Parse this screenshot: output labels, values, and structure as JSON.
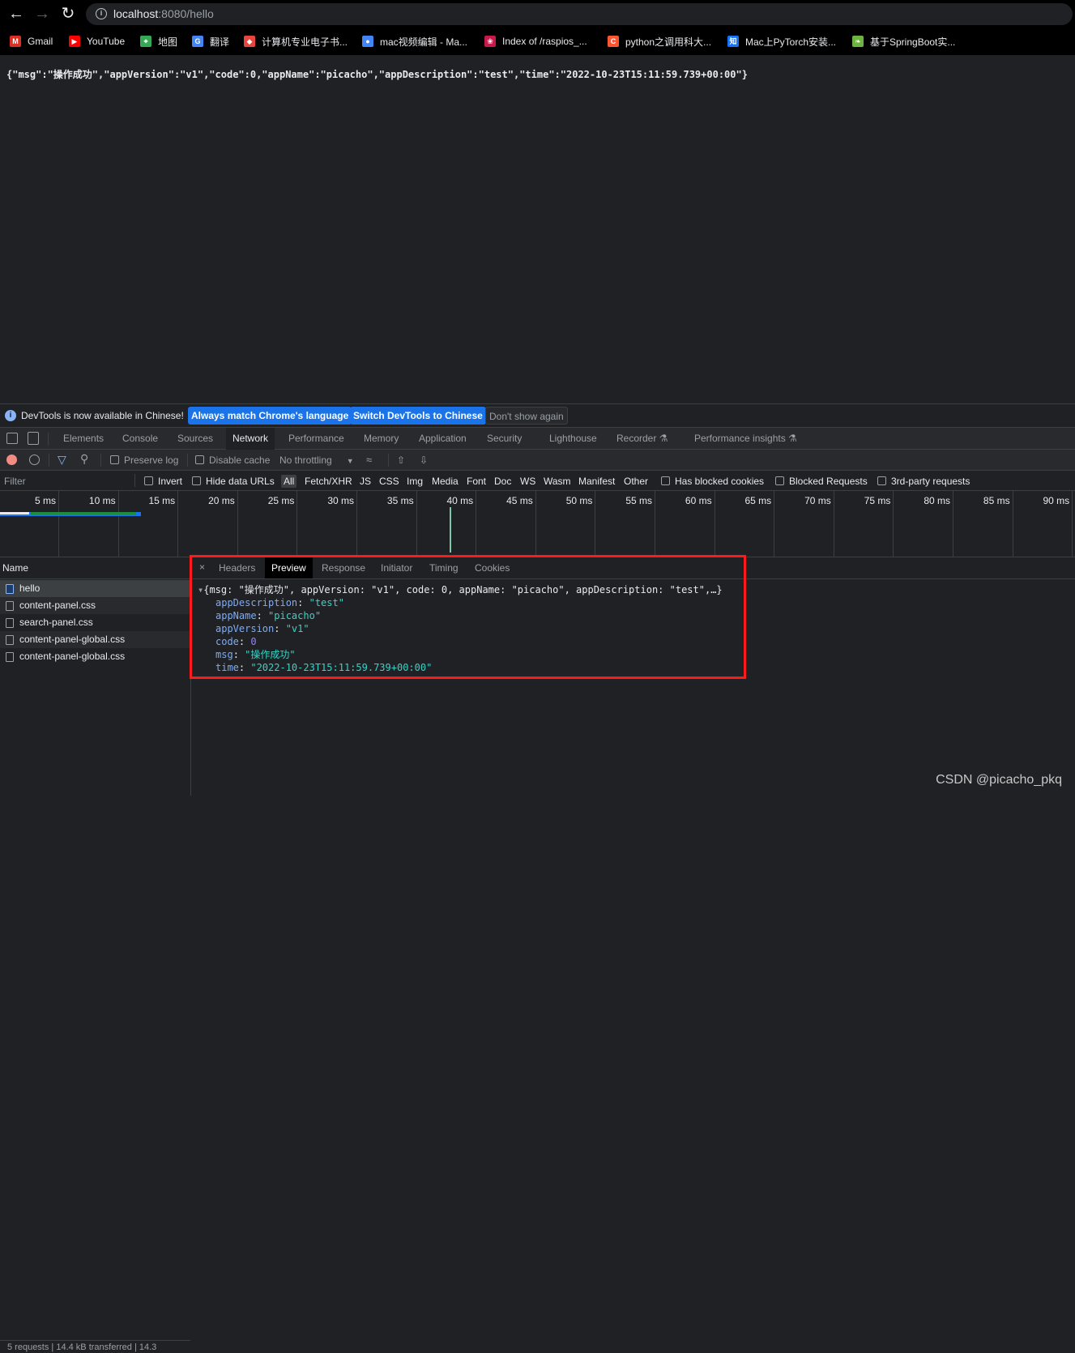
{
  "browser": {
    "url_host": "localhost",
    "url_rest": ":8080/hello"
  },
  "bookmarks": [
    {
      "label": "Gmail",
      "icon": "gmail-icon",
      "color": "#d93025",
      "glyph": "M"
    },
    {
      "label": "YouTube",
      "icon": "youtube-icon",
      "color": "#ff0000",
      "glyph": "▶"
    },
    {
      "label": "地图",
      "icon": "maps-icon",
      "color": "#34a853",
      "glyph": "⌖"
    },
    {
      "label": "翻译",
      "icon": "translate-icon",
      "color": "#4285f4",
      "glyph": "G"
    },
    {
      "label": "计算机专业电子书...",
      "icon": "book-icon",
      "color": "#e8453c",
      "glyph": "◆"
    },
    {
      "label": "mac视频编辑 - Ma...",
      "icon": "globe-icon",
      "color": "#4285f4",
      "glyph": "●"
    },
    {
      "label": "Index of /raspios_...",
      "icon": "raspberry-icon",
      "color": "#c51a4a",
      "glyph": "❀"
    },
    {
      "label": "python之调用科大...",
      "icon": "csdn-icon",
      "color": "#fc5531",
      "glyph": "C"
    },
    {
      "label": "Mac上PyTorch安装...",
      "icon": "zhihu-icon",
      "color": "#1772f6",
      "glyph": "知"
    },
    {
      "label": "基于SpringBoot实...",
      "icon": "spring-icon",
      "color": "#6db33f",
      "glyph": "❧"
    }
  ],
  "page": {
    "json_text": "{\"msg\":\"操作成功\",\"appVersion\":\"v1\",\"code\":0,\"appName\":\"picacho\",\"appDescription\":\"test\",\"time\":\"2022-10-23T15:11:59.739+00:00\"}"
  },
  "infobar": {
    "message": "DevTools is now available in Chinese!",
    "btn_match": "Always match Chrome's language",
    "btn_switch": "Switch DevTools to Chinese",
    "btn_dismiss": "Don't show again"
  },
  "devtools_tabs": [
    "Elements",
    "Console",
    "Sources",
    "Network",
    "Performance",
    "Memory",
    "Application",
    "Security",
    "Lighthouse",
    "Recorder ⚗",
    "Performance insights ⚗"
  ],
  "network_toolbar": {
    "preserve_log": "Preserve log",
    "disable_cache": "Disable cache",
    "throttling": "No throttling"
  },
  "filter_bar": {
    "filter_placeholder": "Filter",
    "invert": "Invert",
    "hide_data_urls": "Hide data URLs",
    "types": [
      "All",
      "Fetch/XHR",
      "JS",
      "CSS",
      "Img",
      "Media",
      "Font",
      "Doc",
      "WS",
      "Wasm",
      "Manifest",
      "Other"
    ],
    "blocked_cookies": "Has blocked cookies",
    "blocked_requests": "Blocked Requests",
    "third_party": "3rd-party requests"
  },
  "timeline": {
    "labels": [
      "5 ms",
      "10 ms",
      "15 ms",
      "20 ms",
      "25 ms",
      "30 ms",
      "35 ms",
      "40 ms",
      "45 ms",
      "50 ms",
      "55 ms",
      "60 ms",
      "65 ms",
      "70 ms",
      "75 ms",
      "80 ms",
      "85 ms",
      "90 ms"
    ]
  },
  "requests": {
    "header": "Name",
    "items": [
      "hello",
      "content-panel.css",
      "search-panel.css",
      "content-panel-global.css",
      "content-panel-global.css"
    ],
    "status": "5 requests | 14.4 kB transferred | 14.3"
  },
  "detail_tabs": [
    "Headers",
    "Preview",
    "Response",
    "Initiator",
    "Timing",
    "Cookies"
  ],
  "preview": {
    "summary": "{msg: \"操作成功\", appVersion: \"v1\", code: 0, appName: \"picacho\", appDescription: \"test\",…}",
    "fields": [
      {
        "key": "appDescription",
        "value": "\"test\"",
        "kind": "string"
      },
      {
        "key": "appName",
        "value": "\"picacho\"",
        "kind": "string"
      },
      {
        "key": "appVersion",
        "value": "\"v1\"",
        "kind": "string"
      },
      {
        "key": "code",
        "value": "0",
        "kind": "number"
      },
      {
        "key": "msg",
        "value": "\"操作成功\"",
        "kind": "string"
      },
      {
        "key": "time",
        "value": "\"2022-10-23T15:11:59.739+00:00\"",
        "kind": "string"
      }
    ]
  },
  "watermark": "CSDN @picacho_pkq"
}
